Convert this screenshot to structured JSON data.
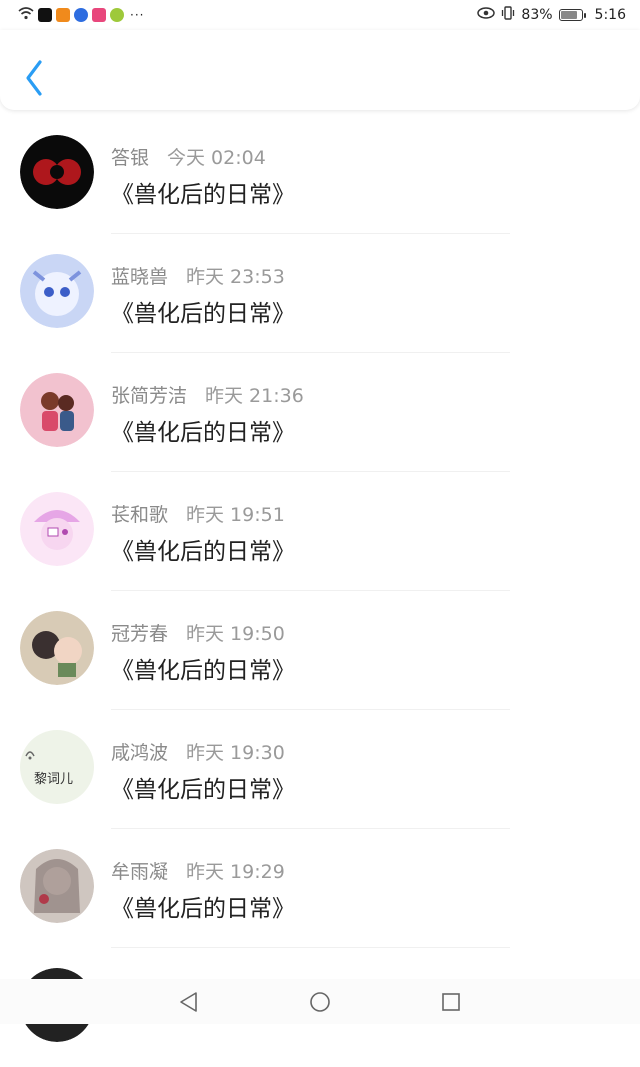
{
  "status_bar": {
    "battery": "83%",
    "time": "5:16",
    "battery_level": 0.83,
    "app_icons": [
      "tiktok-icon",
      "video-icon",
      "baidu-icon",
      "app-icon",
      "lightbulb-icon"
    ]
  },
  "header": {
    "back_icon": "chevron-left-icon",
    "accent": "#2a9df4"
  },
  "comments": [
    {
      "name": "答银",
      "time": "今天 02:04",
      "title": "《兽化后的日常》",
      "avatar_color": "#c0181e"
    },
    {
      "name": "蓝晓兽",
      "time": "昨天 23:53",
      "title": "《兽化后的日常》",
      "avatar_color": "#8fa6e8"
    },
    {
      "name": "张简芳洁",
      "time": "昨天 21:36",
      "title": "《兽化后的日常》",
      "avatar_color": "#e88aa4"
    },
    {
      "name": "苌和歌",
      "time": "昨天 19:51",
      "title": "《兽化后的日常》",
      "avatar_color": "#d890e0"
    },
    {
      "name": "冠芳春",
      "time": "昨天 19:50",
      "title": "《兽化后的日常》",
      "avatar_color": "#b6a58a"
    },
    {
      "name": "咸鸿波",
      "time": "昨天 19:30",
      "title": "《兽化后的日常》",
      "avatar_color": "#e9efe2",
      "avatar_text": "黎词儿"
    },
    {
      "name": "牟雨凝",
      "time": "昨天 19:29",
      "title": "《兽化后的日常》",
      "avatar_color": "#9e9a96"
    }
  ],
  "nav": {
    "back_icon": "triangle-back-icon",
    "home_icon": "circle-home-icon",
    "recent_icon": "square-recent-icon"
  }
}
